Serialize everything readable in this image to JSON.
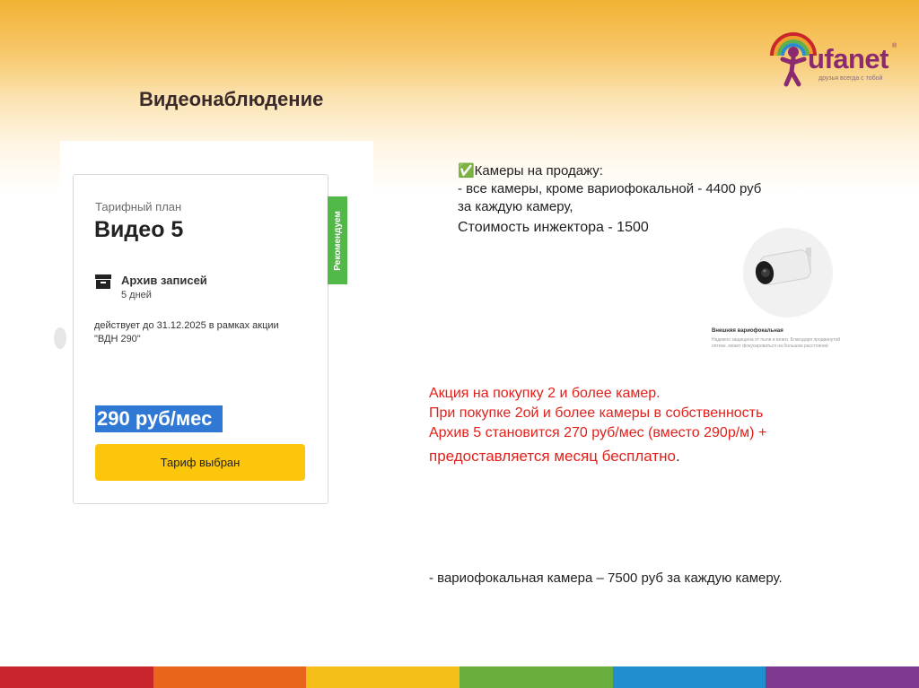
{
  "slide": {
    "title": "Видеонаблюдение"
  },
  "logo": {
    "name": "ufanet",
    "registered": "®",
    "tagline": "друзья всегда с тобой"
  },
  "tariff_card": {
    "label": "Тарифный план",
    "plan_name": "Видео 5",
    "archive_title": "Архив записей",
    "archive_days": "5 дней",
    "promo_line1": "действует до 31.12.2025 в рамках акции",
    "promo_line2": "\"ВДН 290\"",
    "price": "290 руб/мес",
    "button_label": "Тариф выбран",
    "recommend_badge": "Рекомендуем"
  },
  "cameras_sale": {
    "heading": "✅Камеры на продажу:",
    "line1": "- все камеры, кроме вариофокальной - 4400 руб",
    "line2": "за каждую камеру,",
    "injector": "Стоимость инжектора - 1500"
  },
  "camera_image": {
    "caption": "Внешняя вариофокальная",
    "desc_line1": "Надежно защищена от пыли и влаги. Благодаря продвинутой",
    "desc_line2": "оптике, может фокусироваться на большом расстоянии"
  },
  "promo": {
    "line1": "Акция на покупку 2 и более камер.",
    "line2": "При покупке 2ой и более камеры в собственность",
    "line3": "Архив 5 становится 270 руб/мес (вместо 290р/м) +",
    "line4": "предоставляется месяц бесплатно",
    "line4_end": "."
  },
  "vario_camera": {
    "text": "- вариофокальная камера – 7500 руб за каждую камеру."
  },
  "colors": {
    "accent_red": "#e3201b",
    "button_yellow": "#fcc60c",
    "badge_green": "#52b848",
    "price_highlight": "#2f78d3",
    "footer_stripes": [
      "#c9252c",
      "#e8661c",
      "#f5bf1a",
      "#6aaf3d",
      "#1f8fcf",
      "#7e3a8e"
    ]
  }
}
